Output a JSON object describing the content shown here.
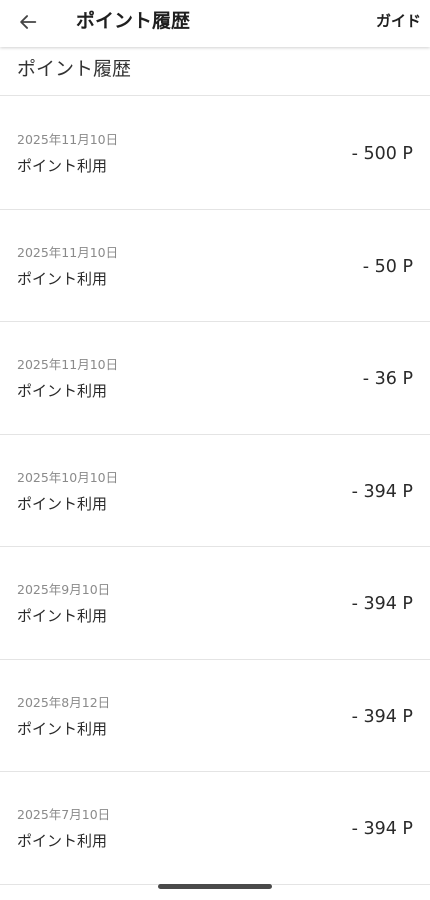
{
  "app_bar": {
    "title": "ポイント履歴",
    "back_icon": "arrow-left-icon",
    "guide_label": "ガイド"
  },
  "section": {
    "title": "ポイント履歴"
  },
  "history": [
    {
      "date": "2025年11月10日",
      "type": "ポイント利用",
      "points": "- 500 P"
    },
    {
      "date": "2025年11月10日",
      "type": "ポイント利用",
      "points": "- 50 P"
    },
    {
      "date": "2025年11月10日",
      "type": "ポイント利用",
      "points": "- 36 P"
    },
    {
      "date": "2025年10月10日",
      "type": "ポイント利用",
      "points": "- 394 P"
    },
    {
      "date": "2025年9月10日",
      "type": "ポイント利用",
      "points": "- 394 P"
    },
    {
      "date": "2025年8月12日",
      "type": "ポイント利用",
      "points": "- 394 P"
    },
    {
      "date": "2025年7月10日",
      "type": "ポイント利用",
      "points": "- 394 P"
    }
  ],
  "colors": {
    "text": "#222222",
    "date_text": "#8a8a8a",
    "divider": "#e4e4e4",
    "home_indicator": "#4a4a4a"
  }
}
